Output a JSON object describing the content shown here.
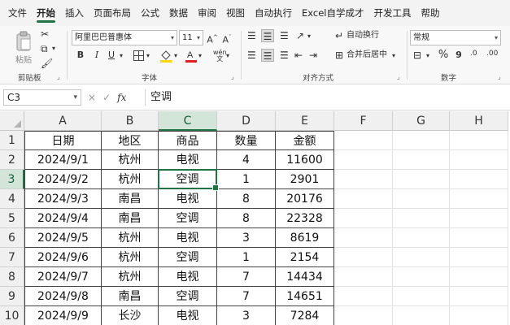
{
  "menu": {
    "tabs": [
      "文件",
      "开始",
      "插入",
      "页面布局",
      "公式",
      "数据",
      "审阅",
      "视图",
      "自动执行",
      "Excel自学成才",
      "开发工具",
      "帮助"
    ],
    "active": 1
  },
  "ribbon": {
    "clipboard": {
      "paste_label": "粘贴",
      "group_label": "剪贴板"
    },
    "font": {
      "font_name": "阿里巴巴普惠体",
      "font_size": "11",
      "grow_label": "A^",
      "shrink_label": "A˅",
      "bold": "B",
      "italic": "I",
      "underline": "U",
      "group_label": "字体"
    },
    "alignment": {
      "wrap_text": "自动换行",
      "merge_center": "合并后居中",
      "group_label": "对齐方式"
    },
    "number": {
      "format": "常规",
      "percent": "%",
      "comma": "9",
      "group_label": "数字"
    },
    "colors": {
      "accent": "#217346",
      "fill_yellow": "#ffd700",
      "font_red": "#e02020"
    }
  },
  "formula_bar": {
    "name_box": "C3",
    "cancel_icon": "×",
    "enter_icon": "✓",
    "fx_label": "fx",
    "formula": "空调"
  },
  "sheet": {
    "columns": [
      "A",
      "B",
      "C",
      "D",
      "E",
      "F",
      "G",
      "H"
    ],
    "rows": [
      "1",
      "2",
      "3",
      "4",
      "5",
      "6",
      "7",
      "8",
      "9",
      "10"
    ],
    "selected_col": "C",
    "selected_row": "3",
    "data": [
      [
        "日期",
        "地区",
        "商品",
        "数量",
        "金额"
      ],
      [
        "2024/9/1",
        "杭州",
        "电视",
        "4",
        "11600"
      ],
      [
        "2024/9/2",
        "杭州",
        "空调",
        "1",
        "2901"
      ],
      [
        "2024/9/3",
        "南昌",
        "电视",
        "8",
        "20176"
      ],
      [
        "2024/9/4",
        "南昌",
        "空调",
        "8",
        "22328"
      ],
      [
        "2024/9/5",
        "杭州",
        "电视",
        "3",
        "8619"
      ],
      [
        "2024/9/6",
        "杭州",
        "空调",
        "1",
        "2154"
      ],
      [
        "2024/9/7",
        "杭州",
        "电视",
        "7",
        "14434"
      ],
      [
        "2024/9/8",
        "南昌",
        "空调",
        "7",
        "14651"
      ],
      [
        "2024/9/9",
        "长沙",
        "电视",
        "3",
        "7284"
      ]
    ]
  }
}
